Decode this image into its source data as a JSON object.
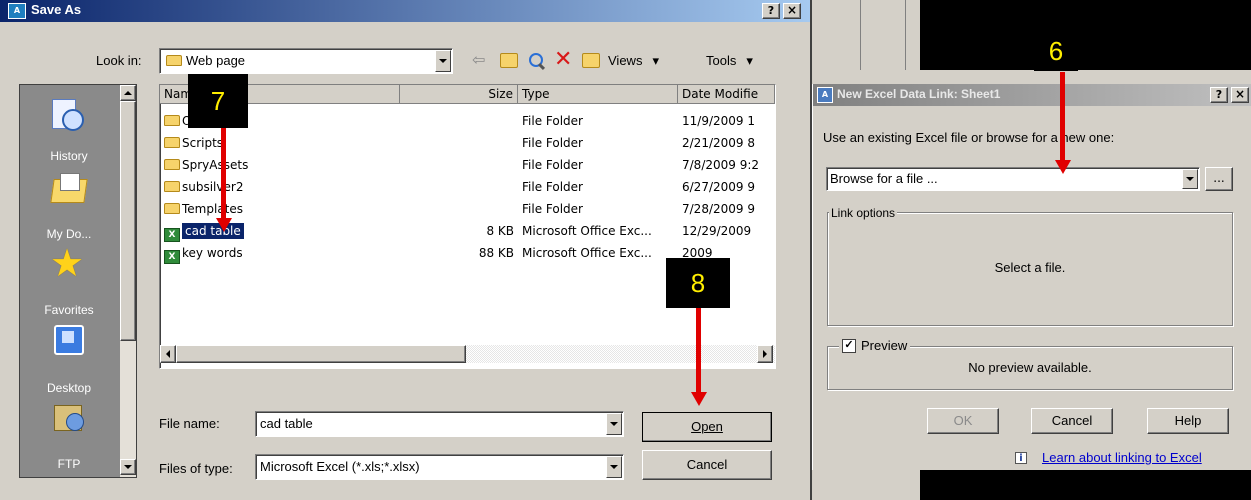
{
  "save_as": {
    "title": "Save As",
    "title_buttons": {
      "help": "?",
      "close": "×"
    },
    "look_in_label": "Look in:",
    "look_in_value": "Web page",
    "toolbar": {
      "views": "Views",
      "tools": "Tools"
    },
    "places": [
      {
        "label": "History"
      },
      {
        "label": "My Do..."
      },
      {
        "label": "Favorites"
      },
      {
        "label": "Desktop"
      },
      {
        "label": "FTP"
      }
    ],
    "columns": {
      "name": "Name",
      "size": "Size",
      "type": "Type",
      "date": "Date Modifie"
    },
    "files": [
      {
        "name": "Old Link",
        "size": "",
        "type": "File Folder",
        "date": "11/9/2009 1",
        "kind": "folder"
      },
      {
        "name": "Scripts",
        "size": "",
        "type": "File Folder",
        "date": "2/21/2009 8",
        "kind": "folder"
      },
      {
        "name": "SpryAssets",
        "size": "",
        "type": "File Folder",
        "date": "7/8/2009 9:2",
        "kind": "folder"
      },
      {
        "name": "subsilver2",
        "size": "",
        "type": "File Folder",
        "date": "6/27/2009 9",
        "kind": "folder"
      },
      {
        "name": "Templates",
        "size": "",
        "type": "File Folder",
        "date": "7/28/2009 9",
        "kind": "folder"
      },
      {
        "name": "cad table",
        "size": "8 KB",
        "type": "Microsoft Office Exc...",
        "date": "12/29/2009",
        "kind": "excel",
        "selected": true
      },
      {
        "name": "key words",
        "size": "88 KB",
        "type": "Microsoft Office Exc...",
        "date": "2009",
        "kind": "excel"
      }
    ],
    "file_name_label": "File name:",
    "file_name_value": "cad table",
    "files_of_type_label": "Files of type:",
    "files_of_type_value": "Microsoft Excel (*.xls;*.xlsx)",
    "open_button": "Open",
    "cancel_button": "Cancel"
  },
  "data_link": {
    "title": "New Excel Data Link: Sheet1",
    "title_buttons": {
      "help": "?",
      "close": "×"
    },
    "instruction": "Use an existing Excel file or browse for a new one:",
    "browse_value": "Browse for a file ...",
    "browse_button": "...",
    "link_options_label": "Link options",
    "select_file_text": "Select a file.",
    "preview_label": "Preview",
    "no_preview_text": "No preview available.",
    "ok_button": "OK",
    "cancel_button": "Cancel",
    "help_button": "Help",
    "learn_link": "Learn about linking to Excel"
  },
  "callouts": {
    "c6": "6",
    "c7": "7",
    "c8": "8"
  },
  "colors": {
    "title_bar": "#0a246a",
    "title_bar_end": "#a6caf0",
    "arrow": "#e00000",
    "callout_text": "#ffee00",
    "selection": "#0a246a"
  }
}
